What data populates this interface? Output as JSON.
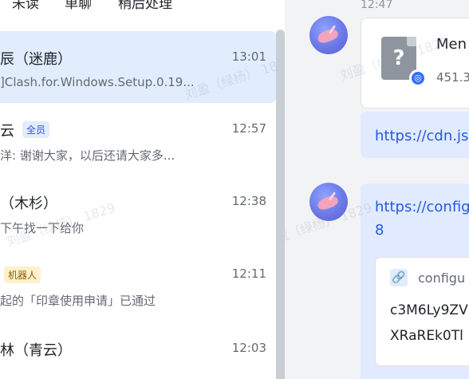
{
  "tabs": [
    {
      "label": "未读"
    },
    {
      "label": "单聊"
    },
    {
      "label": "稍后处理"
    },
    {
      "label": "···"
    }
  ],
  "conversations": [
    {
      "name": "辰（迷鹿）",
      "time": "13:01",
      "preview": "]Clash.for.Windows.Setup.0.19..."
    },
    {
      "name": "云",
      "badge": "全员",
      "time": "12:57",
      "preview": "洋: 谢谢大家，以后还请大家多..."
    },
    {
      "name": "（木杉）",
      "time": "12:38",
      "preview": "下午找一下给你"
    },
    {
      "name": "",
      "badge": "机器人",
      "time": "12:11",
      "preview": "起的「印章使用申请」已通过"
    },
    {
      "name": "林（青云）",
      "time": "12:03",
      "preview": ""
    }
  ],
  "chat": {
    "top_time": "12:47",
    "file": {
      "name": "Men",
      "size": "451.3"
    },
    "link1": "https://cdn.js",
    "link2_line1": "https://config",
    "link2_line2": "8",
    "preview_label": "configu",
    "code_line1": "c3M6Ly9ZV",
    "code_line2": "XRaREk0Tl"
  },
  "watermark": "刘盈（绿杨） 1829",
  "icons": {
    "file": "unknown-file-icon",
    "sync": "sync-icon",
    "link": "link-icon"
  },
  "colors": {
    "accent": "#245bdb",
    "selected_bg": "#e1ecfd",
    "chat_bg": "#f2f3f5",
    "bubble_bg": "#e1eaff"
  }
}
